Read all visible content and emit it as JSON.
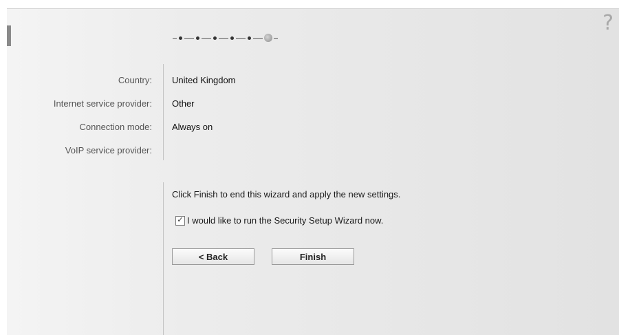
{
  "help": {
    "icon": "question-mark-icon",
    "glyph": "?"
  },
  "progress": {
    "total_steps": 6,
    "current_step": 6
  },
  "summary": {
    "rows": [
      {
        "label": "Country:",
        "value": "United Kingdom"
      },
      {
        "label": "Internet service provider:",
        "value": "Other"
      },
      {
        "label": "Connection mode:",
        "value": "Always on"
      },
      {
        "label": "VoIP service provider:",
        "value": ""
      }
    ]
  },
  "finish_message": "Click Finish to end this wizard and apply the new settings.",
  "security_wizard_checkbox": {
    "label": "I would like to run the Security Setup Wizard now.",
    "checked": true,
    "mark": "✓"
  },
  "buttons": {
    "back": "< Back",
    "finish": "Finish"
  }
}
